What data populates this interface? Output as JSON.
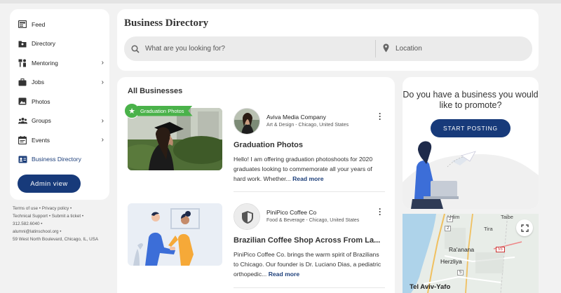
{
  "sidebar": {
    "items": [
      {
        "label": "Feed",
        "icon": "feed-icon"
      },
      {
        "label": "Directory",
        "icon": "directory-folder-icon"
      },
      {
        "label": "Mentoring",
        "icon": "mentoring-icon"
      },
      {
        "label": "Jobs",
        "icon": "briefcase-icon"
      },
      {
        "label": "Photos",
        "icon": "photo-icon"
      },
      {
        "label": "Groups",
        "icon": "groups-icon"
      },
      {
        "label": "Events",
        "icon": "calendar-icon"
      },
      {
        "label": "Business Directory",
        "icon": "business-card-icon"
      }
    ],
    "admin_label": "Admin view"
  },
  "footer": {
    "terms": "Terms of use",
    "privacy": "Privacy policy",
    "support": "Technical Support",
    "ticket": "Submit a ticket",
    "phone": "312.582.6040",
    "email": "alumni@latinschool.org",
    "address": "59 West North Boulevard, Chicago, IL, USA"
  },
  "header": {
    "title": "Business Directory",
    "search_placeholder": "What are you looking for?",
    "location_placeholder": "Location"
  },
  "list": {
    "title": "All Businesses",
    "businesses": [
      {
        "tag": "Graduation Photos",
        "company": "Aviva Media Company",
        "category": "Art & Design - Chicago, United States",
        "title": "Graduation Photos",
        "description": "Hello!  I am offering graduation photoshoots for 2020 graduates looking to commemorate all your years of hard work. Whether...",
        "read_more": "Read more"
      },
      {
        "company": "PiniPico Coffee Co",
        "category": "Food & Beverage - Chicago, United States",
        "title": "Brazilian Coffee Shop Across From La...",
        "description": "PiniPico Coffee Co. brings the warm spirit of Brazilians to Chicago. Our founder is Dr. Luciano Dias, a pediatric orthopedic...",
        "read_more": "Read more"
      }
    ]
  },
  "promo": {
    "question": "Do you have a business you would like to promote?",
    "button": "START POSTING"
  },
  "map": {
    "labels": {
      "udim": "Udim",
      "taibe": "Taibe",
      "tira": "Tira",
      "raanana": "Ra'anana",
      "herzliya": "Herzliya",
      "telaviv": "Tel Aviv-Yafo",
      "r2a": "2",
      "r2b": "2",
      "r5": "5",
      "r55": "55"
    }
  },
  "colors": {
    "brand_navy": "#173a7a",
    "tag_green": "#4ab24a",
    "background": "#f2f2f2"
  }
}
